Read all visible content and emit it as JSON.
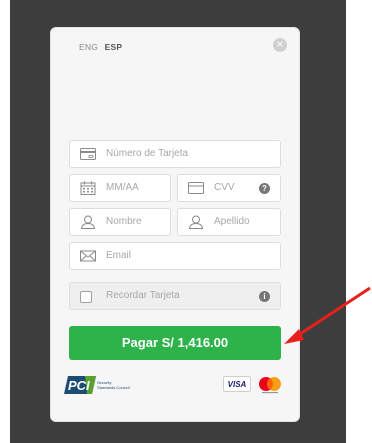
{
  "lang": {
    "eng": "ENG",
    "esp": "ESP"
  },
  "form": {
    "card_number_placeholder": "Número de Tarjeta",
    "expiry_placeholder": "MM/AA",
    "cvv_placeholder": "CVV",
    "first_name_placeholder": "Nombre",
    "last_name_placeholder": "Apellido",
    "email_placeholder": "Email",
    "remember_label": "Recordar Tarjeta"
  },
  "pay_button": {
    "label": "Pagar S/ 1,416.00"
  },
  "footer": {
    "pci_logo": "PCI",
    "pci_caption_1": "Security",
    "pci_caption_2": "Standards Council",
    "visa_logo": "VISA"
  },
  "colors": {
    "accent": "#2eb24a",
    "arrow": "#e8201b",
    "backdrop": "#3d3d3d"
  }
}
